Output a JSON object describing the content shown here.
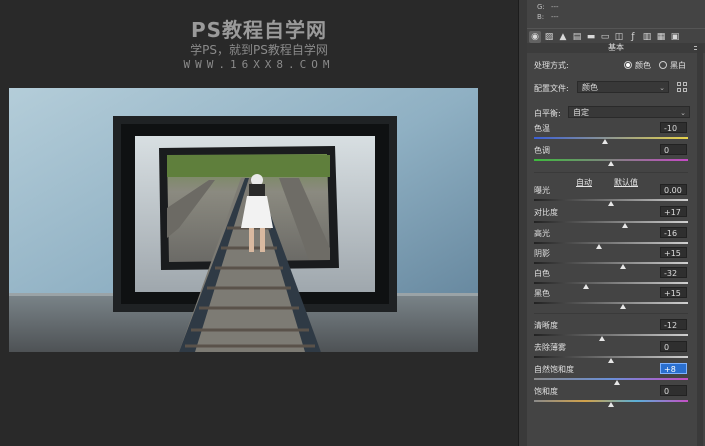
{
  "watermark": {
    "title": "PS教程自学网",
    "subtitle": "学PS，就到PS教程自学网",
    "url": "WWW.16XX8.COM"
  },
  "panel": {
    "rgb": [
      {
        "ch": "G:",
        "val": "---"
      },
      {
        "ch": "B:",
        "val": "---"
      }
    ],
    "section_title": "基本",
    "treatment_label": "处理方式:",
    "treatment_color": "颜色",
    "treatment_bw": "黑白",
    "profile_label": "配置文件:",
    "profile_value": "颜色",
    "wb_label": "白平衡:",
    "wb_value": "自定",
    "auto_label": "自动",
    "default_label": "默认值",
    "sliders": [
      {
        "label": "色温",
        "value": "-10",
        "pos": 0.46,
        "track": "temp"
      },
      {
        "label": "色调",
        "value": "0",
        "pos": 0.5,
        "track": "tint"
      },
      {
        "label": "曝光",
        "value": "0.00",
        "pos": 0.5,
        "track": "gray"
      },
      {
        "label": "对比度",
        "value": "+17",
        "pos": 0.59,
        "track": "gray"
      },
      {
        "label": "高光",
        "value": "-16",
        "pos": 0.42,
        "track": "gray"
      },
      {
        "label": "阴影",
        "value": "+15",
        "pos": 0.58,
        "track": "gray"
      },
      {
        "label": "白色",
        "value": "-32",
        "pos": 0.34,
        "track": "gray"
      },
      {
        "label": "黑色",
        "value": "+15",
        "pos": 0.58,
        "track": "gray"
      },
      {
        "label": "清晰度",
        "value": "-12",
        "pos": 0.44,
        "track": "gray"
      },
      {
        "label": "去除薄雾",
        "value": "0",
        "pos": 0.5,
        "track": "gray"
      },
      {
        "label": "自然饱和度",
        "value": "+8",
        "pos": 0.54,
        "track": "vib",
        "focused": true
      },
      {
        "label": "饱和度",
        "value": "0",
        "pos": 0.5,
        "track": "sat"
      }
    ]
  }
}
